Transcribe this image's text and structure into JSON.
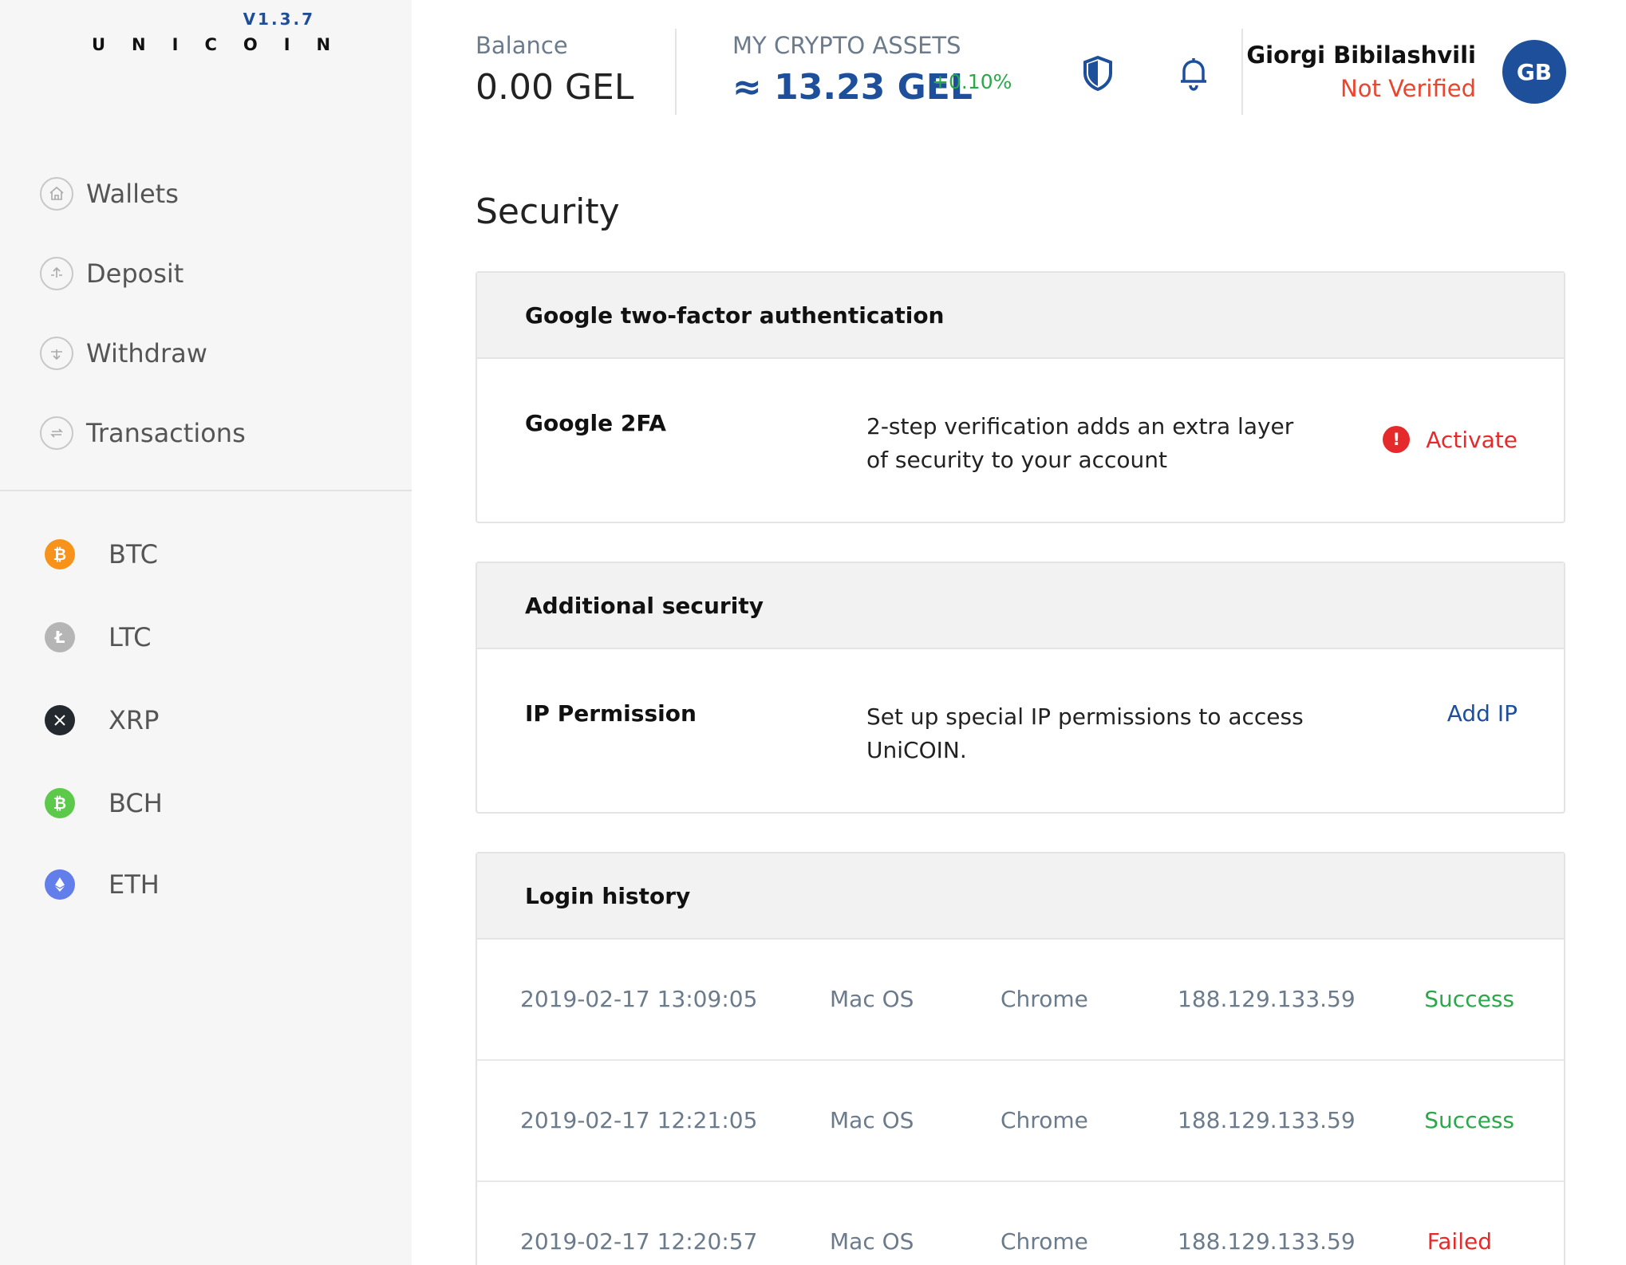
{
  "brand": {
    "version": "V1.3.7",
    "name": "UNICOIN"
  },
  "sidebar": {
    "nav": [
      {
        "label": "Wallets",
        "icon": "home-icon"
      },
      {
        "label": "Deposit",
        "icon": "deposit-arrow-icon"
      },
      {
        "label": "Withdraw",
        "icon": "withdraw-arrow-icon"
      },
      {
        "label": "Transactions",
        "icon": "exchange-arrows-icon"
      }
    ],
    "coins": [
      {
        "symbol": "BTC",
        "icon": "bitcoin-icon",
        "color": "#f7931a"
      },
      {
        "symbol": "LTC",
        "icon": "litecoin-icon",
        "color": "#b5b5b5"
      },
      {
        "symbol": "XRP",
        "icon": "ripple-icon",
        "color": "#23292f"
      },
      {
        "symbol": "BCH",
        "icon": "bitcoin-cash-icon",
        "color": "#5cc94a"
      },
      {
        "symbol": "ETH",
        "icon": "ethereum-icon",
        "color": "#627eea"
      }
    ]
  },
  "header": {
    "balance_label": "Balance",
    "balance_value": "0.00 GEL",
    "assets_label": "MY CRYPTO ASSETS",
    "assets_value": "≈ 13.23 GEL",
    "assets_change": "+0.10%",
    "user_name": "Giorgi Bibilashvili",
    "user_status": "Not Verified",
    "avatar_initials": "GB"
  },
  "page": {
    "title": "Security"
  },
  "two_factor": {
    "title": "Google two-factor authentication",
    "name": "Google 2FA",
    "description": "2-step verification adds an extra layer of security to your account",
    "action": "Activate",
    "action_icon_glyph": "!"
  },
  "additional": {
    "title": "Additional security",
    "name": "IP Permission",
    "description": "Set up special IP permissions to access UniCOIN.",
    "action": "Add IP"
  },
  "login_history": {
    "title": "Login history",
    "rows": [
      {
        "datetime": "2019-02-17 13:09:05",
        "os": "Mac OS",
        "browser": "Chrome",
        "ip": "188.129.133.59",
        "status": "Success"
      },
      {
        "datetime": "2019-02-17 12:21:05",
        "os": "Mac OS",
        "browser": "Chrome",
        "ip": "188.129.133.59",
        "status": "Success"
      },
      {
        "datetime": "2019-02-17 12:20:57",
        "os": "Mac OS",
        "browser": "Chrome",
        "ip": "188.129.133.59",
        "status": "Failed"
      }
    ]
  },
  "colors": {
    "brand_blue": "#1d4f9a",
    "success": "#2aa84a",
    "failed": "#e42a2a",
    "warning": "#e9452f"
  }
}
